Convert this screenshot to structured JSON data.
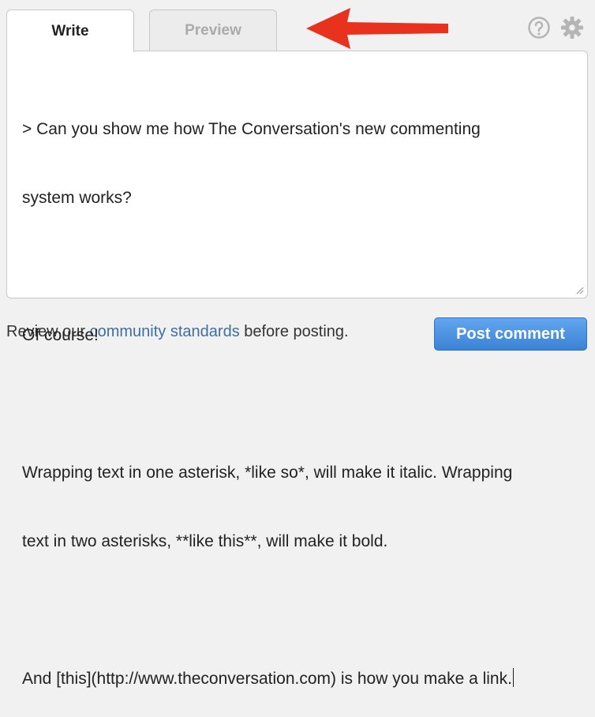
{
  "tabs": {
    "write": "Write",
    "preview": "Preview",
    "active": "Write"
  },
  "toolbar_icons": [
    "help-icon",
    "gear-icon"
  ],
  "editor": {
    "lines": [
      "> Can you show me how The Conversation's new commenting",
      "system works?",
      "",
      "Of course!",
      "",
      "Wrapping text in one asterisk, *like so*, will make it italic. Wrapping",
      "text in two asterisks, **like this**, will make it bold.",
      "",
      "And [this](http://www.theconversation.com) is how you make a link."
    ]
  },
  "footer": {
    "prefix": "Review our ",
    "link": "community standards",
    "suffix": " before posting."
  },
  "post_button": "Post comment",
  "colors": {
    "link": "#3e6fa3",
    "button": "#4a90e2",
    "arrow": "#e8321e"
  }
}
